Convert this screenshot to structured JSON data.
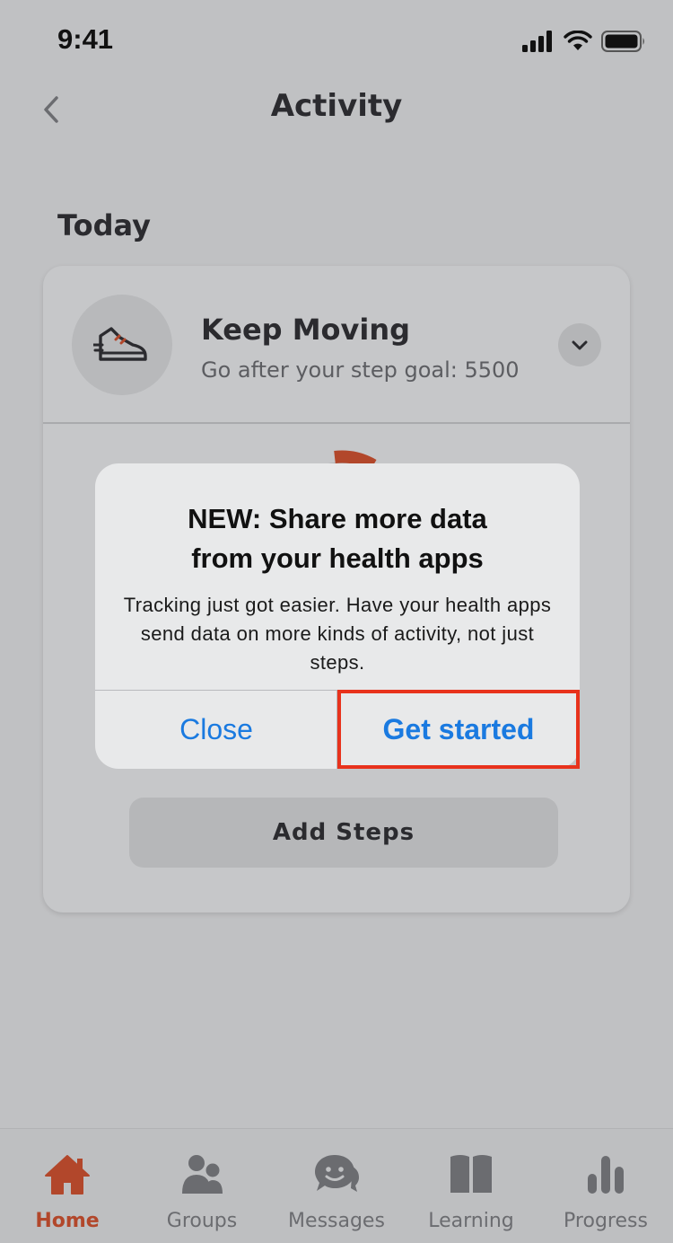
{
  "status_bar": {
    "time": "9:41"
  },
  "nav": {
    "title": "Activity"
  },
  "section": {
    "title": "Today"
  },
  "card": {
    "title": "Keep Moving",
    "subtitle": "Go after your step goal: 5500",
    "add_steps_label": "Add Steps"
  },
  "alert": {
    "title_line1": "NEW: Share more data",
    "title_line2": "from your health apps",
    "message": "Tracking just got easier. Have your health apps send data on more kinds of activity, not just steps.",
    "close_label": "Close",
    "primary_label": "Get started"
  },
  "tabs": [
    {
      "label": "Home",
      "icon": "home-icon",
      "active": true
    },
    {
      "label": "Groups",
      "icon": "groups-icon",
      "active": false
    },
    {
      "label": "Messages",
      "icon": "messages-icon",
      "active": false
    },
    {
      "label": "Learning",
      "icon": "book-icon",
      "active": false
    },
    {
      "label": "Progress",
      "icon": "bar-chart-icon",
      "active": false
    }
  ],
  "colors": {
    "accent": "#b2472b",
    "link_blue": "#1a7ae0",
    "highlight_red": "#e8321c"
  }
}
